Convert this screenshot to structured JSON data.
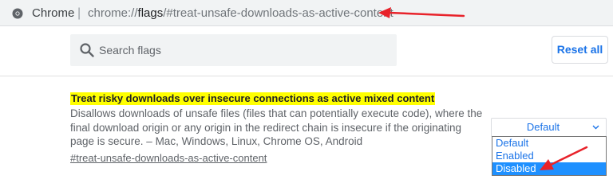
{
  "browser": {
    "name": "Chrome",
    "separator": "|",
    "url_scheme": "chrome://",
    "url_host": "flags",
    "url_path": "/#treat-unsafe-downloads-as-active-content"
  },
  "search": {
    "placeholder": "Search flags",
    "value": ""
  },
  "reset_label": "Reset all",
  "flag": {
    "title": "Treat risky downloads over insecure connections as active mixed content",
    "description": "Disallows downloads of unsafe files (files that can potentially execute code), where the final download origin or any origin in the redirect chain is insecure if the originating page is secure. – Mac, Windows, Linux, Chrome OS, Android",
    "link": "#treat-unsafe-downloads-as-active-content",
    "select_value": "Default",
    "options": [
      "Default",
      "Enabled",
      "Disabled"
    ],
    "highlighted_option": "Disabled"
  },
  "colors": {
    "accent": "#1a73e8",
    "highlight": "#ffff00",
    "annotation_arrow": "#e8222a",
    "option_selected_bg": "#1e90ff"
  },
  "icons": [
    "chrome-info-icon",
    "search-icon",
    "chevron-down-icon"
  ]
}
